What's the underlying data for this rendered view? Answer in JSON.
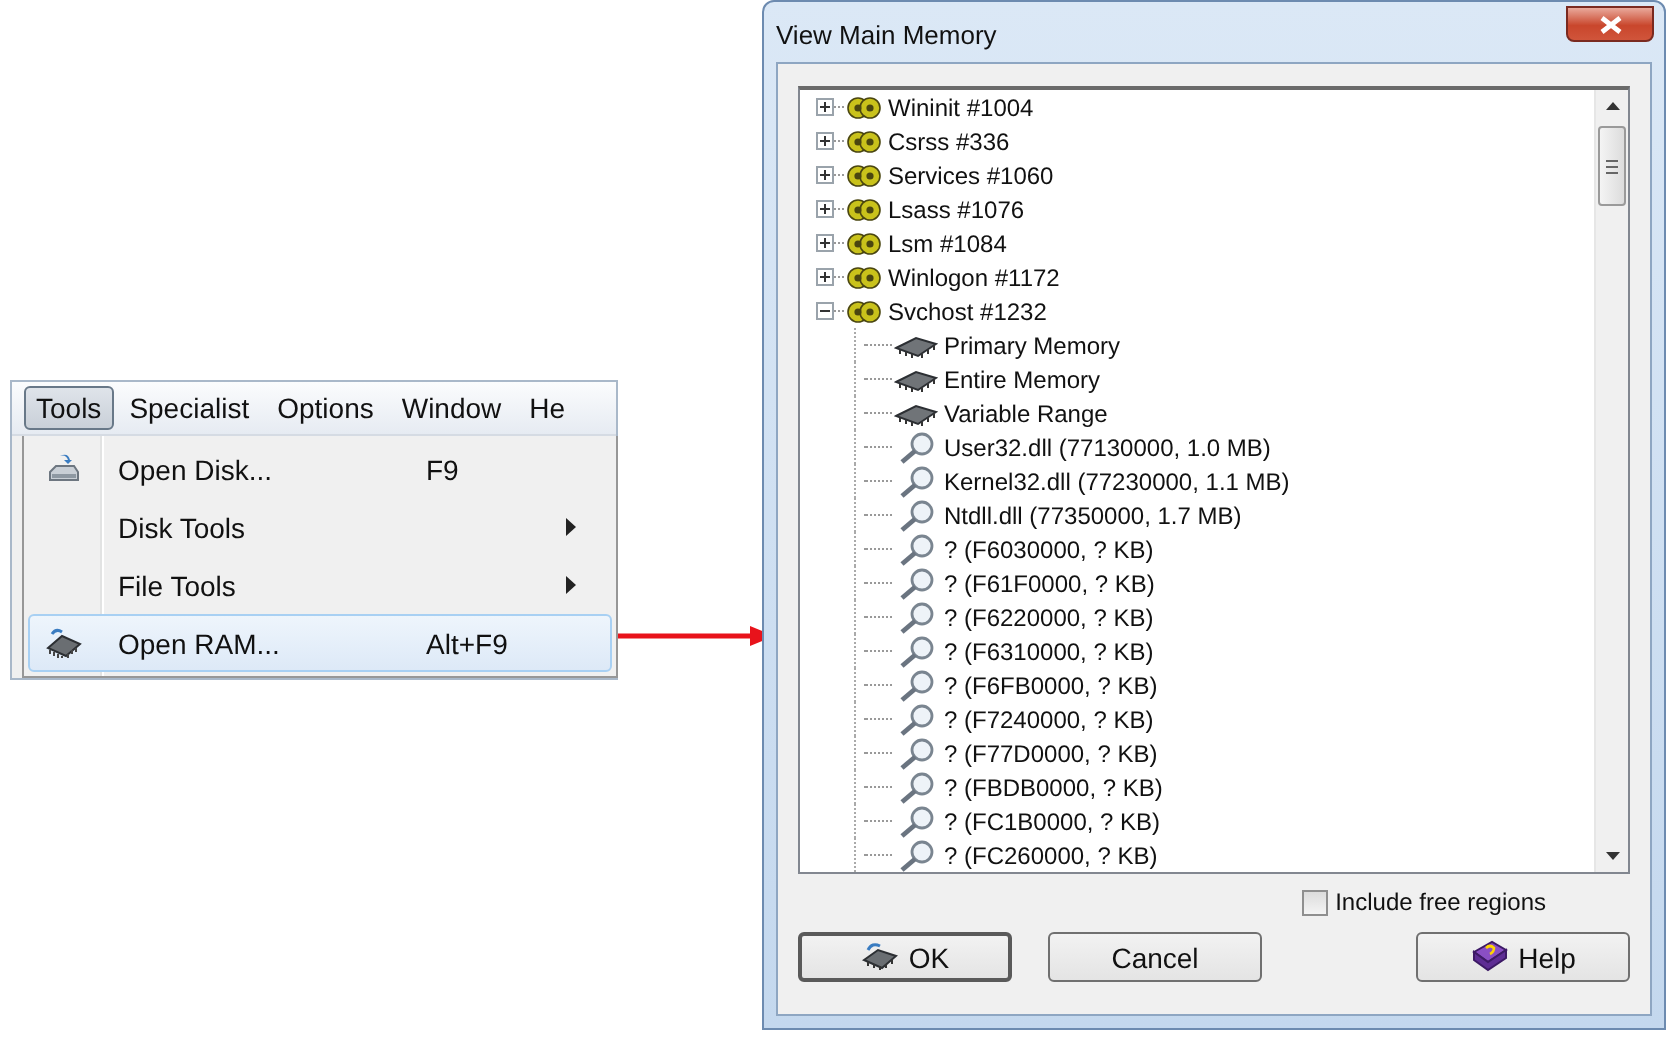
{
  "menubar": [
    {
      "label": "Tools",
      "selected": true
    },
    {
      "label": "Specialist",
      "selected": false
    },
    {
      "label": "Options",
      "selected": false
    },
    {
      "label": "Window",
      "selected": false
    },
    {
      "label": "He",
      "selected": false
    }
  ],
  "menu": [
    {
      "label": "Open Disk...",
      "shortcut": "F9",
      "submenu": false,
      "selected": false
    },
    {
      "label": "Disk Tools",
      "submenu": true,
      "selected": false
    },
    {
      "label": "File Tools",
      "submenu": true,
      "selected": false
    },
    {
      "label": "Open RAM...",
      "shortcut": "Alt+F9",
      "submenu": false,
      "selected": true
    }
  ],
  "dialog": {
    "title": "View Main Memory",
    "tree": [
      {
        "label": "Wininit #1004",
        "kind": "process",
        "expanded": false
      },
      {
        "label": "Csrss #336",
        "kind": "process",
        "expanded": false
      },
      {
        "label": "Services #1060",
        "kind": "process",
        "expanded": false
      },
      {
        "label": "Lsass #1076",
        "kind": "process",
        "expanded": false
      },
      {
        "label": "Lsm #1084",
        "kind": "process",
        "expanded": false
      },
      {
        "label": "Winlogon #1172",
        "kind": "process",
        "expanded": false
      },
      {
        "label": "Svchost #1232",
        "kind": "process",
        "expanded": true,
        "children": [
          {
            "label": "Primary Memory",
            "kind": "memory"
          },
          {
            "label": "Entire Memory",
            "kind": "memory"
          },
          {
            "label": "Variable Range",
            "kind": "memory"
          },
          {
            "label": "User32.dll (77130000, 1.0 MB)",
            "kind": "module"
          },
          {
            "label": "Kernel32.dll (77230000, 1.1 MB)",
            "kind": "module"
          },
          {
            "label": "Ntdll.dll (77350000, 1.7 MB)",
            "kind": "module"
          },
          {
            "label": "? (F6030000, ? KB)",
            "kind": "module"
          },
          {
            "label": "? (F61F0000, ? KB)",
            "kind": "module"
          },
          {
            "label": "? (F6220000, ? KB)",
            "kind": "module"
          },
          {
            "label": "? (F6310000, ? KB)",
            "kind": "module"
          },
          {
            "label": "? (F6FB0000, ? KB)",
            "kind": "module"
          },
          {
            "label": "? (F7240000, ? KB)",
            "kind": "module"
          },
          {
            "label": "? (F77D0000, ? KB)",
            "kind": "module"
          },
          {
            "label": "? (FBDB0000, ? KB)",
            "kind": "module"
          },
          {
            "label": "? (FC1B0000, ? KB)",
            "kind": "module"
          },
          {
            "label": "? (FC260000, ? KB)",
            "kind": "module"
          }
        ]
      }
    ],
    "checkbox": {
      "label": "Include free regions",
      "checked": false
    },
    "buttons": [
      {
        "label": "OK",
        "kind": "ok"
      },
      {
        "label": "Cancel",
        "kind": "cancel"
      },
      {
        "label": "Help",
        "kind": "help"
      }
    ]
  }
}
